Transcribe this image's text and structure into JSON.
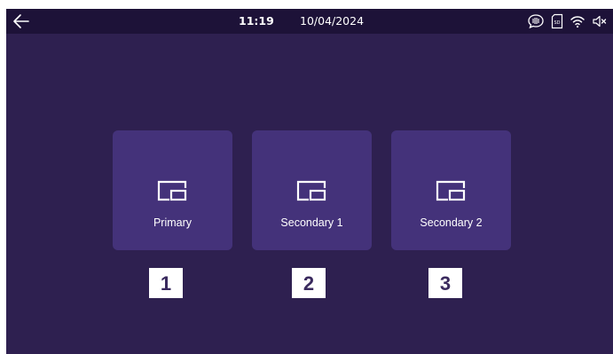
{
  "status_bar": {
    "time": "11:19",
    "date": "10/04/2024",
    "icons": [
      "back-arrow-icon",
      "intercom-bubble-icon",
      "sd-card-icon",
      "wifi-icon",
      "speaker-muted-icon"
    ],
    "sd_label": "SD"
  },
  "tiles": [
    {
      "label": "Primary",
      "icon": "picture-in-picture-icon",
      "number": "1"
    },
    {
      "label": "Secondary 1",
      "icon": "picture-in-picture-icon",
      "number": "2"
    },
    {
      "label": "Secondary 2",
      "icon": "picture-in-picture-icon",
      "number": "3"
    }
  ],
  "colors": {
    "background": "#2e2050",
    "status_bar": "#1d1238",
    "tile": "#44327a",
    "badge_text": "#3a2a5e"
  }
}
